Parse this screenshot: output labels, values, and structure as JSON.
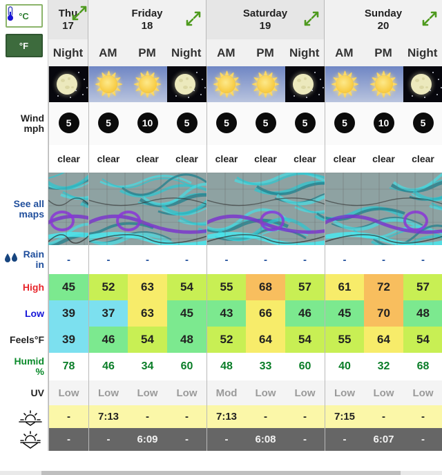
{
  "units": {
    "celsius_label": "°C",
    "fahrenheit_label": "°F",
    "selected": "°F"
  },
  "days": [
    {
      "name": "Thu",
      "date": "17",
      "slots": [
        "Night"
      ]
    },
    {
      "name": "Friday",
      "date": "18",
      "slots": [
        "AM",
        "PM",
        "Night"
      ]
    },
    {
      "name": "Saturday",
      "date": "19",
      "slots": [
        "AM",
        "PM",
        "Night"
      ]
    },
    {
      "name": "Sunday",
      "date": "20",
      "slots": [
        "AM",
        "PM",
        "Night"
      ]
    }
  ],
  "labels": {
    "wind": "Wind",
    "wind_unit": "mph",
    "see_all_maps": "See all maps",
    "rain": "Rain",
    "rain_unit": "in",
    "high": "High",
    "low": "Low",
    "feels": "Feels°F",
    "humid": "Humid",
    "humid_unit": "%",
    "uv": "UV"
  },
  "icons": {
    "expand": "expand-arrows-icon",
    "celsius": "celsius-toggle",
    "fahrenheit": "fahrenheit-toggle",
    "clear_night": "moon-clear-icon",
    "clear_day": "sun-clear-icon",
    "rain_drops": "rain-drops-icon",
    "thermometer_high": "thermometer-red-icon",
    "thermometer_low": "thermometer-blue-icon",
    "sunrise": "sunrise-icon",
    "sunset": "sunset-icon",
    "wind_arrow": "wind-direction-arrow"
  },
  "colors": {
    "accent_green": "#3d6b3d",
    "link_blue": "#1f4e9c",
    "high_red": "#e8262c",
    "low_blue": "#1616d8",
    "humid_green": "#0a8a2a",
    "sunrise_bg": "#fbf7a8",
    "sunset_bg": "#666666"
  },
  "columns": [
    {
      "day": "Thu",
      "slot": "Night",
      "sky": "night",
      "wind_speed": "5",
      "wind_dir": 135,
      "condition": "clear",
      "rain": "-",
      "high": "45",
      "high_bg": "#7ce98f",
      "low": "39",
      "low_bg": "#7ce0ef",
      "feels": "39",
      "feels_bg": "#7ce0ef",
      "humid": "78",
      "uv": "Low",
      "sunrise": "-",
      "sunset": "-"
    },
    {
      "day": "Friday",
      "slot": "AM",
      "sky": "day",
      "wind_speed": "5",
      "wind_dir": 180,
      "condition": "clear",
      "rain": "-",
      "high": "52",
      "high_bg": "#c8ef54",
      "low": "37",
      "low_bg": "#7ce0ef",
      "feels": "46",
      "feels_bg": "#7ce98f",
      "humid": "46",
      "uv": "Low",
      "sunrise": "7:13",
      "sunset": "-"
    },
    {
      "day": "Friday",
      "slot": "PM",
      "sky": "day",
      "wind_speed": "10",
      "wind_dir": 225,
      "condition": "clear",
      "rain": "-",
      "high": "63",
      "high_bg": "#f7ec6a",
      "low": "63",
      "low_bg": "#f7ec6a",
      "feels": "54",
      "feels_bg": "#c8ef54",
      "humid": "34",
      "uv": "Low",
      "sunrise": "-",
      "sunset": "6:09"
    },
    {
      "day": "Friday",
      "slot": "Night",
      "sky": "night",
      "wind_speed": "5",
      "wind_dir": 135,
      "condition": "clear",
      "rain": "-",
      "high": "54",
      "high_bg": "#c8ef54",
      "low": "45",
      "low_bg": "#7ce98f",
      "feels": "48",
      "feels_bg": "#7ce98f",
      "humid": "60",
      "uv": "Low",
      "sunrise": "-",
      "sunset": "-"
    },
    {
      "day": "Saturday",
      "slot": "AM",
      "sky": "day",
      "wind_speed": "5",
      "wind_dir": 180,
      "condition": "clear",
      "rain": "-",
      "high": "55",
      "high_bg": "#c8ef54",
      "low": "43",
      "low_bg": "#7ce98f",
      "feels": "52",
      "feels_bg": "#c8ef54",
      "humid": "48",
      "uv": "Mod",
      "sunrise": "7:13",
      "sunset": "-"
    },
    {
      "day": "Saturday",
      "slot": "PM",
      "sky": "day",
      "wind_speed": "5",
      "wind_dir": 20,
      "condition": "clear",
      "rain": "-",
      "high": "68",
      "high_bg": "#f8be5e",
      "low": "66",
      "low_bg": "#f7ec6a",
      "feels": "64",
      "feels_bg": "#f7ec6a",
      "humid": "33",
      "uv": "Low",
      "sunrise": "-",
      "sunset": "6:08"
    },
    {
      "day": "Saturday",
      "slot": "Night",
      "sky": "night",
      "wind_speed": "5",
      "wind_dir": 90,
      "condition": "clear",
      "rain": "-",
      "high": "57",
      "high_bg": "#c8ef54",
      "low": "46",
      "low_bg": "#7ce98f",
      "feels": "54",
      "feels_bg": "#c8ef54",
      "humid": "60",
      "uv": "Low",
      "sunrise": "-",
      "sunset": "-"
    },
    {
      "day": "Sunday",
      "slot": "AM",
      "sky": "day",
      "wind_speed": "5",
      "wind_dir": 135,
      "condition": "clear",
      "rain": "-",
      "high": "61",
      "high_bg": "#f7ec6a",
      "low": "45",
      "low_bg": "#7ce98f",
      "feels": "55",
      "feels_bg": "#c8ef54",
      "humid": "40",
      "uv": "Low",
      "sunrise": "7:15",
      "sunset": "-"
    },
    {
      "day": "Sunday",
      "slot": "PM",
      "sky": "day",
      "wind_speed": "10",
      "wind_dir": 90,
      "condition": "clear",
      "rain": "-",
      "high": "72",
      "high_bg": "#f8be5e",
      "low": "70",
      "low_bg": "#f8be5e",
      "feels": "64",
      "feels_bg": "#f7ec6a",
      "humid": "32",
      "uv": "Low",
      "sunrise": "-",
      "sunset": "6:07"
    },
    {
      "day": "Sunday",
      "slot": "Night",
      "sky": "night",
      "wind_speed": "5",
      "wind_dir": 90,
      "condition": "clear",
      "rain": "-",
      "high": "57",
      "high_bg": "#c8ef54",
      "low": "48",
      "low_bg": "#7ce98f",
      "feels": "54",
      "feels_bg": "#c8ef54",
      "humid": "68",
      "uv": "Low",
      "sunrise": "-",
      "sunset": "-"
    }
  ]
}
